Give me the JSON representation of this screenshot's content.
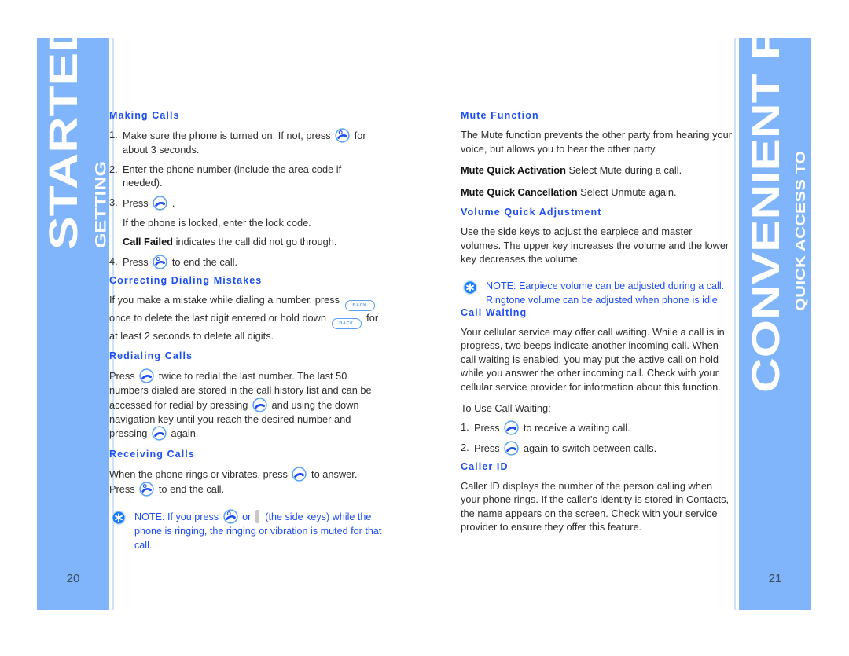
{
  "left_page": {
    "tab": {
      "small_label": "GETTING",
      "big_label": "STARTED",
      "color": "#80b4fb"
    },
    "folio": "20",
    "sections": [
      {
        "heading": "Making Calls",
        "items": [
          {
            "n": "1.",
            "before": "Make sure the phone is turned on. If not, press",
            "icon": "end-call-icon",
            "after": "for about 3 seconds."
          },
          {
            "n": "2.",
            "before": "Enter the phone number (include the area code if needed).",
            "icon": "",
            "after": ""
          },
          {
            "n": "3.",
            "before": "Press",
            "icon": "send-call-icon",
            "after": "."
          },
          {
            "n": "4.",
            "before": "Press",
            "icon": "end-call-icon",
            "after": "to end the call."
          }
        ],
        "sub_lines": [
          "If the phone is locked, enter the lock code.",
          "Call Failed indicates the call did not go through."
        ],
        "sub_bold": "Call Failed",
        "sub_bold_rest": " indicates the call did not go through."
      },
      {
        "heading": "Correcting Dialing Mistakes",
        "paragraph_a": "If you make a mistake while dialing a number, press",
        "paragraph_b": "once to delete the last digit entered or hold down",
        "paragraph_c": "for at least 2 seconds to delete all digits.",
        "back_label": "BACK"
      },
      {
        "heading": "Redialing Calls",
        "p1": "Press",
        "p2": "twice to redial the last number. The last 50 numbers dialed are stored in the call history list and can be accessed for redial by pressing",
        "p3": "and using the down navigation key until you reach the desired number and pressing",
        "p4": "again."
      },
      {
        "heading": "Receiving Calls",
        "p1": "When the phone rings or vibrates, press",
        "p2": "to answer. Press",
        "p3": "to end the call."
      }
    ],
    "note": {
      "icon": "note-asterisk-icon",
      "part1": "NOTE: If you press",
      "part2": "or",
      "part3": "(the side keys) while the phone is ringing, the ringing or vibration is muted for that call."
    }
  },
  "right_page": {
    "tab": {
      "small_label": "QUICK ACCESS TO",
      "big_label": "CONVENIENT FEATURES",
      "color": "#80b4fb"
    },
    "folio": "21",
    "sections": [
      {
        "heading": "Mute Function",
        "paragraph": "The Mute function prevents the other party from hearing your voice, but allows you to hear the other party.",
        "defs": [
          {
            "term": "Mute Quick Activation",
            "desc": " Select Mute during a call."
          },
          {
            "term": "Mute Quick Cancellation",
            "desc": " Select Unmute again."
          }
        ]
      },
      {
        "heading": "Volume Quick Adjustment",
        "paragraph": "Use the side keys to adjust the earpiece and master volumes. The upper key increases the volume and the lower key decreases the volume.",
        "note": {
          "icon": "note-asterisk-icon",
          "text": "NOTE: Earpiece volume can be adjusted during a call. Ringtone volume can be adjusted when phone is idle."
        }
      },
      {
        "heading": "Call Waiting",
        "paragraph": "Your cellular service may offer call waiting. While a call is in progress, two beeps indicate another incoming call. When call waiting is enabled, you may put the active call on hold while you answer the other incoming call. Check with your cellular service provider for information about this function.",
        "lead_in": "To Use Call Waiting:",
        "steps": [
          {
            "n": "1.",
            "before": "Press",
            "icon": "send-call-icon",
            "after": "to receive a waiting call."
          },
          {
            "n": "2.",
            "before": "Press",
            "icon": "send-call-icon",
            "after": "again to switch between calls."
          }
        ]
      },
      {
        "heading": "Caller ID",
        "paragraph": "Caller ID displays the number of the person calling when your phone rings. If the caller's identity is stored in Contacts, the name appears on the screen. Check with your service provider to ensure they offer this feature."
      }
    ]
  },
  "colors": {
    "tab_blue": "#80b4fb",
    "heading_blue": "#1f4ff0",
    "note_blue": "#2b57ee",
    "body_gray": "#2e2e2e",
    "rail": "#cfe1fb"
  }
}
